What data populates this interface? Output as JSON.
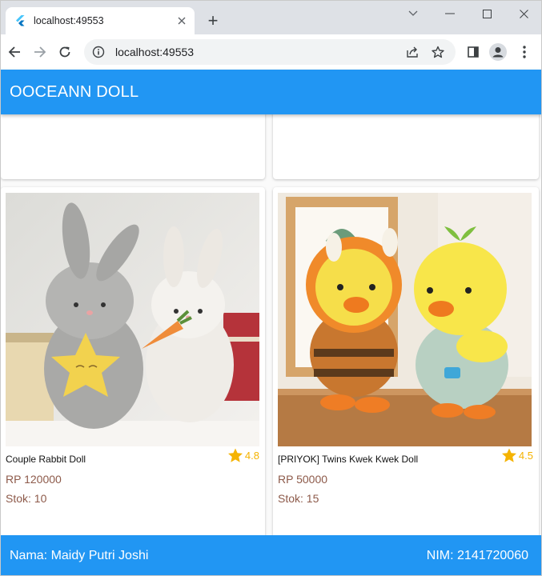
{
  "browser": {
    "tab_title": "localhost:49553",
    "url": "localhost:49553",
    "new_tab_label": "+"
  },
  "icons": {
    "favicon": "flutter-icon",
    "back": "arrow-left-icon",
    "forward": "arrow-right-icon",
    "reload": "reload-icon",
    "info": "info-icon",
    "share": "share-icon",
    "bookmark": "star-icon",
    "side_panel": "side-panel-icon",
    "profile": "profile-icon",
    "menu": "kebab-menu-icon"
  },
  "app": {
    "title": "OOCEANN DOLL",
    "accent_color": "#2196f3"
  },
  "products": [
    {
      "name": "Couple Rabbit Doll",
      "rating": "4.8",
      "price": "RP 120000",
      "stock": "Stok: 10",
      "image": "two plush rabbit dolls, grey and white, grey one holding a yellow star, white one holding a carrot"
    },
    {
      "name": "[PRIYOK] Twins Kwek Kwek Doll",
      "rating": "4.5",
      "price": "RP 50000",
      "stock": "Stok: 15",
      "image": "two yellow plush duck dolls, one in a bee costume, one in green overalls with a sprout"
    }
  ],
  "footer": {
    "nama": "Nama: Maidy Putri Joshi",
    "nim": "NIM: 2141720060"
  }
}
